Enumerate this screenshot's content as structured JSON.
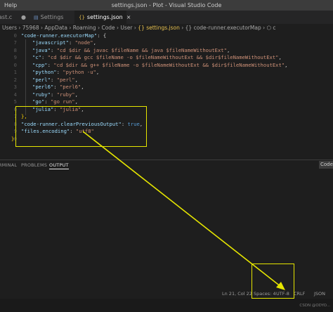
{
  "window": {
    "menu_help": "Help",
    "title": "settings.json - Plot - Visual Studio Code"
  },
  "tabs": [
    {
      "label": "ast.c",
      "icon": "c-file-icon"
    },
    {
      "label": "Settings",
      "icon": "settings-file-icon"
    },
    {
      "label": "settings.json",
      "icon": "json-file-icon",
      "close": "×"
    }
  ],
  "breadcrumb": {
    "path": "Users › 75968 › AppData › Roaming › Code › User › ",
    "file": "{} settings.json",
    "sep": " › ",
    "symbol": "{} code-runner.executorMap",
    "tail": " › ⬡ c"
  },
  "editor": {
    "line_numbers": [
      "0",
      "7",
      "8",
      "9",
      "0",
      "1",
      "2",
      "3",
      "4",
      "5",
      "6",
      "7",
      "8",
      "9",
      "0"
    ],
    "lines": {
      "l1_key": "\"code-runner.executorMap\"",
      "l1_rest": ": {",
      "l2_key": "\"javascript\"",
      "l2_val": "\"node\"",
      "l3_key": "\"java\"",
      "l3_val": "\"cd $dir && javac $fileName && java $fileNameWithoutExt\"",
      "l4_key": "\"c\"",
      "l4_val": "\"cd $dir && gcc $fileName -o $fileNameWithoutExt && $dir$fileNameWithoutExt\"",
      "l5_key": "\"cpp\"",
      "l5_val": "\"cd $dir && g++ $fileName -o $fileNameWithoutExt && $dir$fileNameWithoutExt\"",
      "l6_key": "\"python\"",
      "l6_val": "\"python -u\"",
      "l7_key": "\"perl\"",
      "l7_val": "\"perl\"",
      "l8_key": "\"perl6\"",
      "l8_val": "\"perl6\"",
      "l9_key": "\"ruby\"",
      "l9_val": "\"ruby\"",
      "l10_key": "\"go\"",
      "l10_val": "\"go run\"",
      "l11_key": "\"julia\"",
      "l11_val": "\"julia\"",
      "l12": "},",
      "l13_key": "\"code-runner.clearPreviousOutput\"",
      "l13_val": "true",
      "l14_key": "\"files.encoding\"",
      "l14_val": "\"utf8\"",
      "l15": "}"
    }
  },
  "panel": {
    "tabs": [
      "RMINAL",
      "PROBLEMS",
      "OUTPUT"
    ],
    "active": "OUTPUT",
    "select_value": "Code"
  },
  "status": {
    "position": "Ln 21, Col 22",
    "spaces": "Spaces: 4",
    "encoding": "UTF-8",
    "eol": "CRLF",
    "language": "JSON"
  },
  "watermark": "CSDN @ODYO...",
  "colors": {
    "annotation": "#e6e600",
    "key": "#9cdcfe",
    "string": "#ce9178",
    "bracket": "#ffd700"
  }
}
